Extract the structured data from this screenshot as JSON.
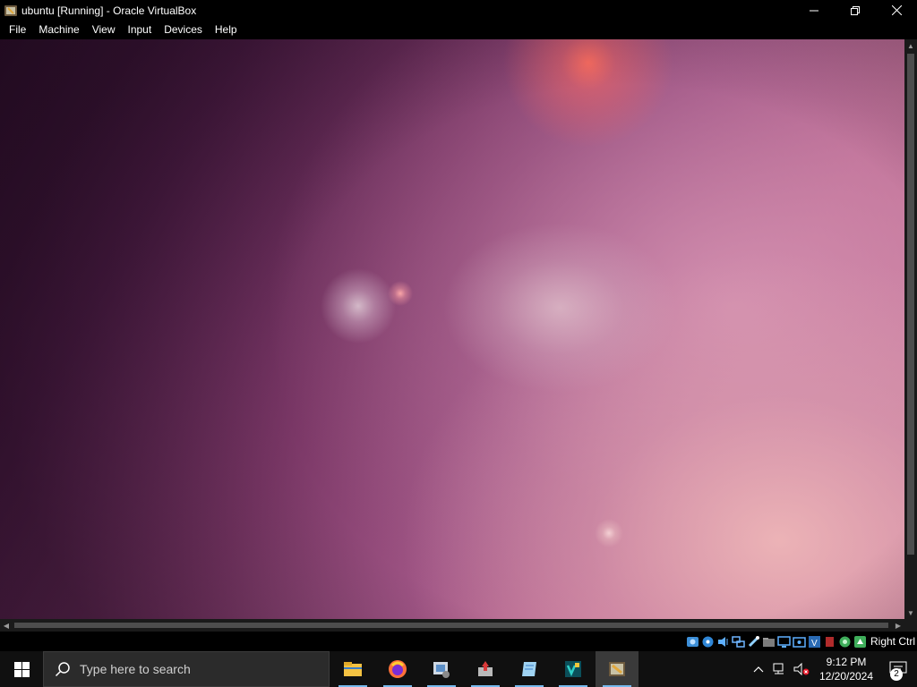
{
  "window": {
    "title": "ubuntu [Running] - Oracle VirtualBox",
    "controls": {
      "minimize": "—",
      "maximize": "❐",
      "close": "✕"
    }
  },
  "menu": [
    "File",
    "Machine",
    "View",
    "Input",
    "Devices",
    "Help"
  ],
  "status_bar": {
    "icons": [
      "hard-disk-icon",
      "optical-drive-icon",
      "audio-icon",
      "network-icon",
      "usb-icon",
      "shared-folders-icon",
      "display-icon",
      "video-capture-icon",
      "virtualization-icon",
      "mouse-integration-icon",
      "keyboard-icon"
    ],
    "host_key": "Right Ctrl"
  },
  "taskbar": {
    "search_placeholder": "Type here to search",
    "apps": [
      "file-explorer",
      "firefox",
      "app-3",
      "app-4",
      "app-5",
      "app-6",
      "virtualbox"
    ],
    "clock_time": "9:12 PM",
    "clock_date": "12/20/2024",
    "notification_count": "2"
  },
  "colors": {
    "taskbar_bg": "#101010",
    "accent": "#76b9ed",
    "window_bg": "#000000"
  }
}
